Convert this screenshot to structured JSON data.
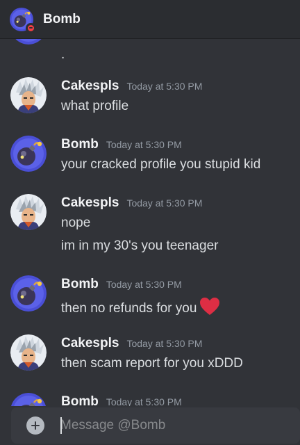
{
  "header": {
    "title": "Bomb",
    "status": "do-not-disturb"
  },
  "partial_top": {
    "text": "."
  },
  "groups": [
    {
      "user": "Cakespls",
      "avatar_icon": "goku-avatar-icon",
      "time": "Today at 5:30 PM",
      "messages": [
        "what profile"
      ]
    },
    {
      "user": "Bomb",
      "avatar_icon": "bomb-avatar-icon",
      "time": "Today at 5:30 PM",
      "messages": [
        "your cracked profile you stupid kid"
      ]
    },
    {
      "user": "Cakespls",
      "avatar_icon": "goku-avatar-icon",
      "time": "Today at 5:30 PM",
      "messages": [
        "nope",
        "im in my 30's you teenager"
      ]
    },
    {
      "user": "Bomb",
      "avatar_icon": "bomb-avatar-icon",
      "time": "Today at 5:30 PM",
      "messages": [
        "then no refunds for you"
      ],
      "emoji": "red-heart-icon"
    },
    {
      "user": "Cakespls",
      "avatar_icon": "goku-avatar-icon",
      "time": "Today at 5:30 PM",
      "messages": [
        "then scam report for you xDDD"
      ]
    },
    {
      "user": "Bomb",
      "avatar_icon": "bomb-avatar-icon",
      "time": "Today at 5:30 PM",
      "messages": []
    }
  ],
  "composer": {
    "placeholder": "Message @Bomb"
  },
  "colors": {
    "background": "#313338",
    "header": "#2b2d31",
    "input": "#383a40",
    "dnd": "#f23f43",
    "heart": "#dd2e44",
    "bomb_bg": "#4a4fd6"
  }
}
